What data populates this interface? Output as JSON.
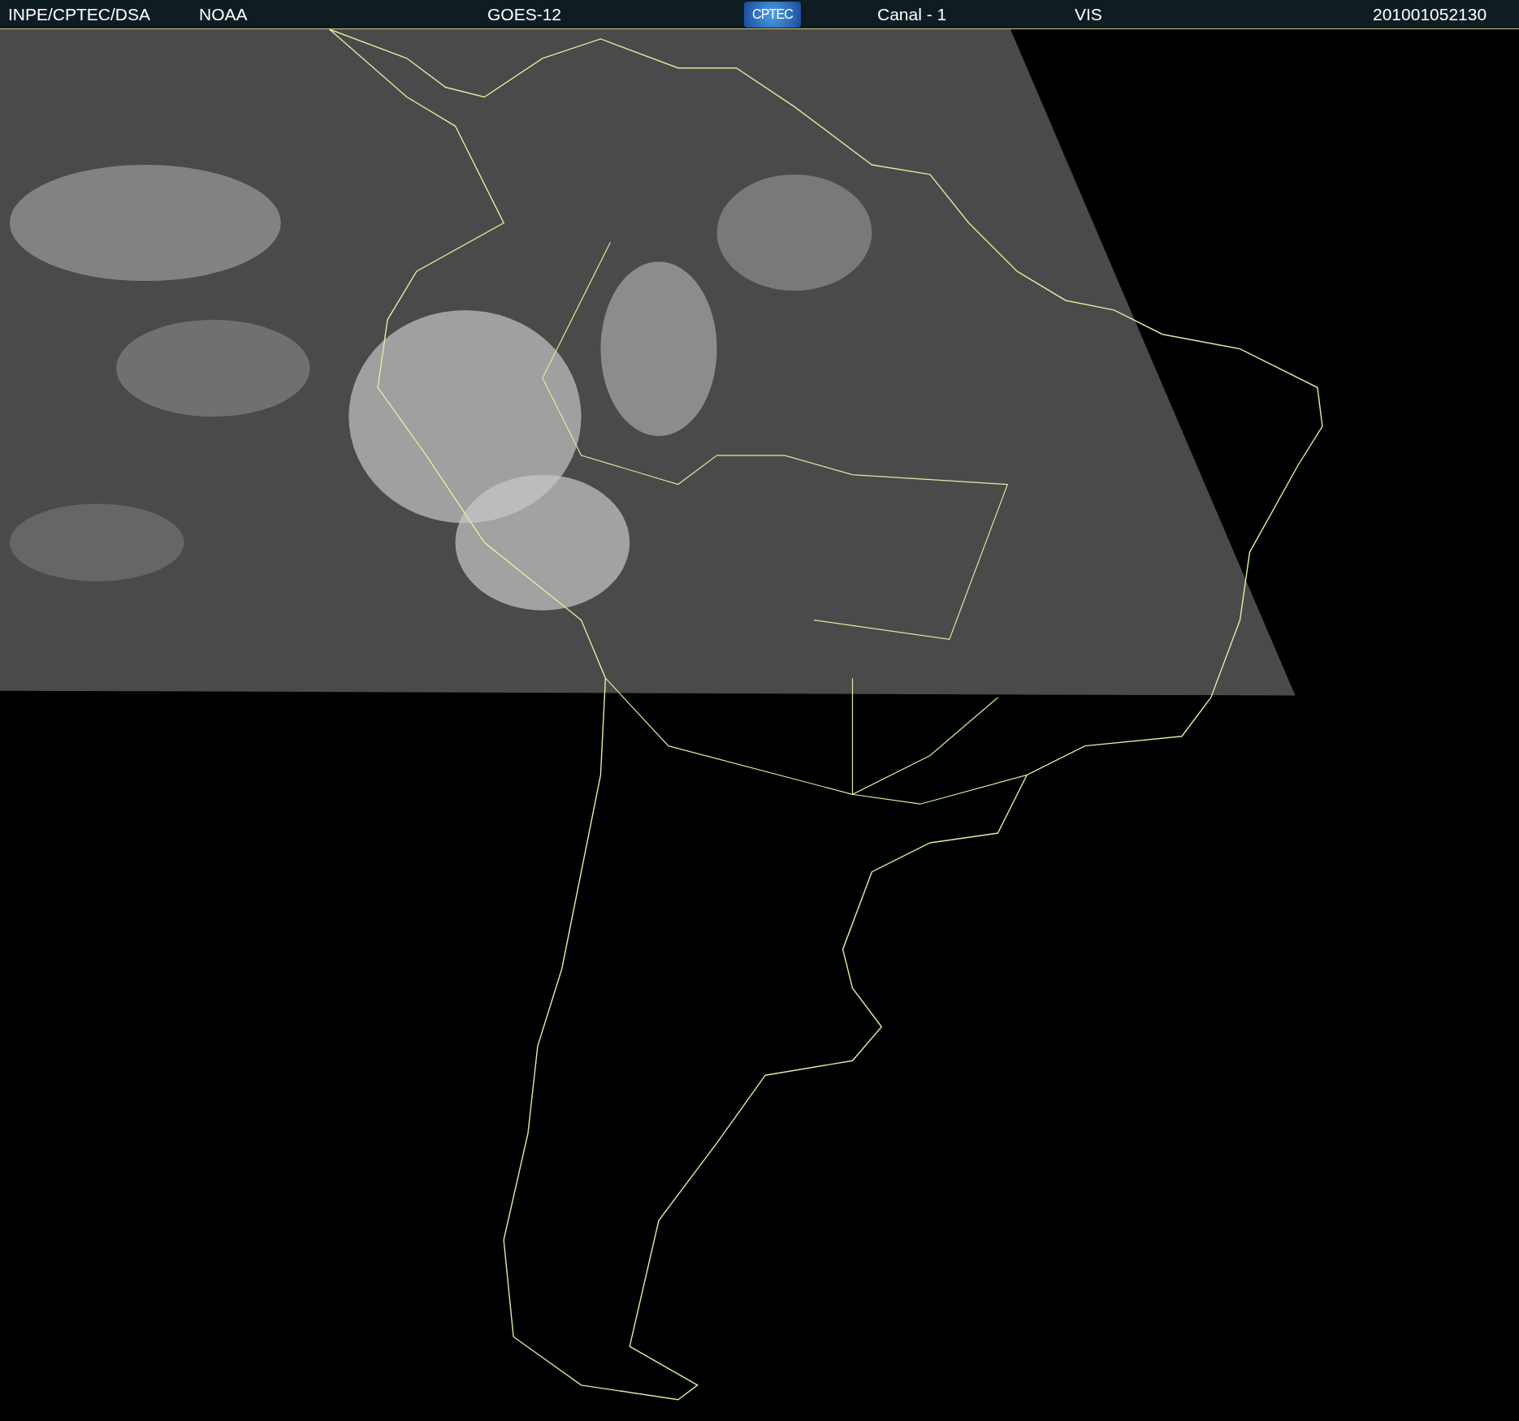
{
  "header": {
    "items": [
      {
        "kind": "text",
        "text": "INPE/CPTEC/DSA"
      },
      {
        "kind": "text",
        "text": "NOAA"
      },
      {
        "kind": "text",
        "text": "GOES-12"
      },
      {
        "kind": "logo",
        "text": "CPTEC"
      },
      {
        "kind": "text",
        "text": "Canal - 1"
      },
      {
        "kind": "text",
        "text": "VIS"
      },
      {
        "kind": "text",
        "text": "201001052130"
      }
    ]
  }
}
